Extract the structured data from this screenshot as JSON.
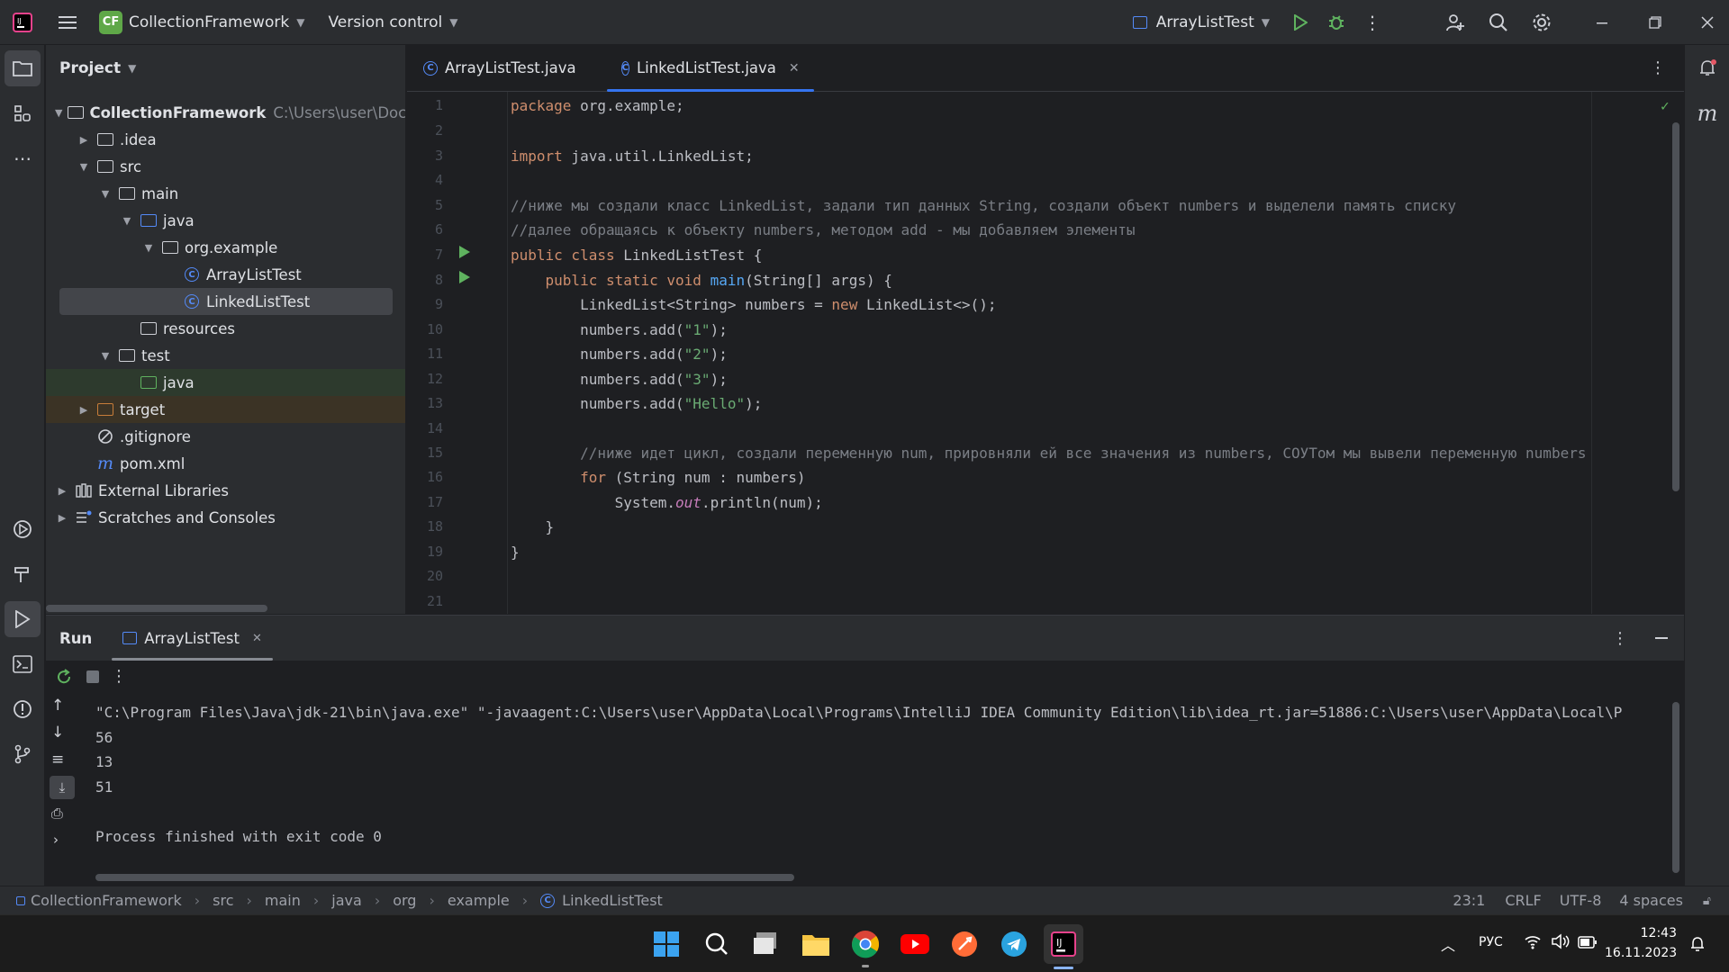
{
  "topbar": {
    "project_badge": "CF",
    "project_name": "CollectionFramework",
    "vcs_label": "Version control",
    "run_config": "ArrayListTest"
  },
  "project_panel": {
    "title": "Project",
    "tree": [
      {
        "label": "CollectionFramework",
        "hint": "C:\\Users\\user\\Doc"
      },
      {
        "label": ".idea"
      },
      {
        "label": "src"
      },
      {
        "label": "main"
      },
      {
        "label": "java"
      },
      {
        "label": "org.example"
      },
      {
        "label": "ArrayListTest"
      },
      {
        "label": "LinkedListTest"
      },
      {
        "label": "resources"
      },
      {
        "label": "test"
      },
      {
        "label": "java"
      },
      {
        "label": "target"
      },
      {
        "label": ".gitignore"
      },
      {
        "label": "pom.xml"
      },
      {
        "label": "External Libraries"
      },
      {
        "label": "Scratches and Consoles"
      }
    ]
  },
  "editor": {
    "tabs": [
      {
        "label": "ArrayListTest.java"
      },
      {
        "label": "LinkedListTest.java"
      }
    ],
    "line_numbers": [
      "1",
      "2",
      "3",
      "4",
      "5",
      "6",
      "7",
      "8",
      "9",
      "10",
      "11",
      "12",
      "13",
      "14",
      "15",
      "16",
      "17",
      "18",
      "19",
      "20",
      "21"
    ]
  },
  "run_panel": {
    "title": "Run",
    "tab_label": "ArrayListTest",
    "output": [
      "\"C:\\Program Files\\Java\\jdk-21\\bin\\java.exe\" \"-javaagent:C:\\Users\\user\\AppData\\Local\\Programs\\IntelliJ IDEA Community Edition\\lib\\idea_rt.jar=51886:C:\\Users\\user\\AppData\\Local\\P",
      "56",
      "13",
      "51",
      "",
      "Process finished with exit code 0"
    ]
  },
  "statusbar": {
    "breadcrumbs": [
      "CollectionFramework",
      "src",
      "main",
      "java",
      "org",
      "example",
      "LinkedListTest"
    ],
    "position": "23:1",
    "line_sep": "CRLF",
    "encoding": "UTF-8",
    "indent": "4 spaces"
  },
  "taskbar": {
    "lang": "РУС",
    "time": "12:43",
    "date": "16.11.2023"
  }
}
